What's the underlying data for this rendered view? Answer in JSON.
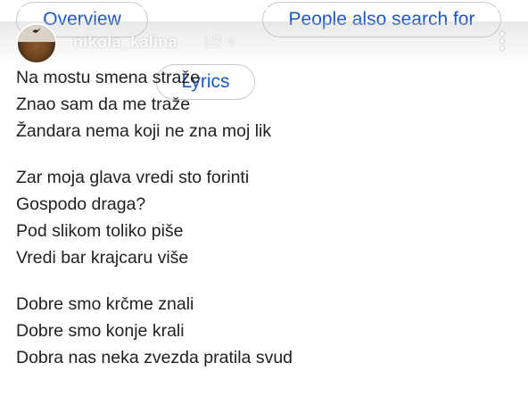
{
  "chips": [
    {
      "label": "Overview"
    },
    {
      "label": "Lyrics"
    },
    {
      "label": "People also search for"
    }
  ],
  "story": {
    "username": "nikola_kalina",
    "time": "10 ч"
  },
  "lyrics": {
    "stanzas": [
      {
        "lines": [
          "Na mostu smena straže",
          "Znao sam da me traže",
          "Žandara nema koji ne zna moj lik"
        ]
      },
      {
        "lines": [
          "Zar moja glava vredi sto forinti",
          "Gospodo draga?",
          "Pod slikom toliko piše",
          "Vredi bar krajcaru više"
        ]
      },
      {
        "lines": [
          "Dobre smo krčme znali",
          "Dobre smo konje krali",
          "Dobra nas neka zvezda pratila svud"
        ]
      }
    ]
  },
  "colors": {
    "chip_text": "#1a56c4",
    "chip_border": "#c6c9ce",
    "lyrics_text": "#202124"
  }
}
